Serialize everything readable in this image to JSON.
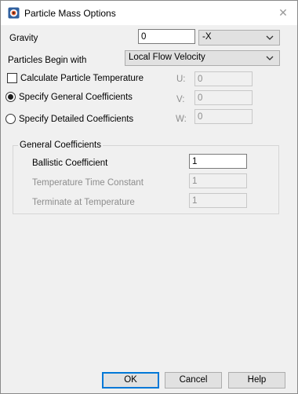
{
  "window": {
    "title": "Particle Mass Options"
  },
  "gravity": {
    "label": "Gravity",
    "value": "0",
    "direction": "-X"
  },
  "particles_begin": {
    "label": "Particles Begin with",
    "value": "Local Flow Velocity"
  },
  "options": {
    "calc_temp": {
      "label": "Calculate Particle Temperature",
      "checked": false
    },
    "general": {
      "label": "Specify General Coefficients",
      "checked": true
    },
    "detailed": {
      "label": "Specify Detailed Coefficients",
      "checked": false
    }
  },
  "velocity": {
    "u_label": "U:",
    "u_value": "0",
    "v_label": "V:",
    "v_value": "0",
    "w_label": "W:",
    "w_value": "0"
  },
  "general_coefficients": {
    "title": "General Coefficients",
    "ballistic_label": "Ballistic Coefficient",
    "ballistic_value": "1",
    "temp_time_label": "Temperature Time Constant",
    "temp_time_value": "1",
    "terminate_label": "Terminate at Temperature",
    "terminate_value": "1"
  },
  "buttons": {
    "ok": "OK",
    "cancel": "Cancel",
    "help": "Help"
  },
  "colors": {
    "accent": "#0078d7",
    "disabled_text": "#8d8d8d"
  }
}
